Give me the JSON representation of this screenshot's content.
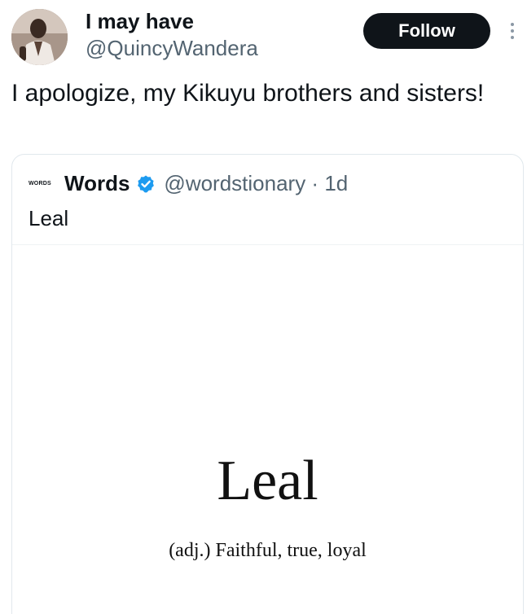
{
  "author": {
    "display_name": "I may have",
    "handle": "@QuincyWandera",
    "avatar_icon": "user-photo-avatar"
  },
  "actions": {
    "follow_label": "Follow",
    "more_icon": "more-vertical-icon"
  },
  "tweet": {
    "text": "I apologize, my Kikuyu brothers and sisters!"
  },
  "quoted": {
    "logo_text": "WORDS",
    "display_name": "Words",
    "verified": true,
    "verified_color": "#1d9bf0",
    "handle_time": "@wordstionary · 1d",
    "text": "Leal",
    "card": {
      "word": "Leal",
      "definition": "(adj.) Faithful, true, loyal"
    }
  }
}
